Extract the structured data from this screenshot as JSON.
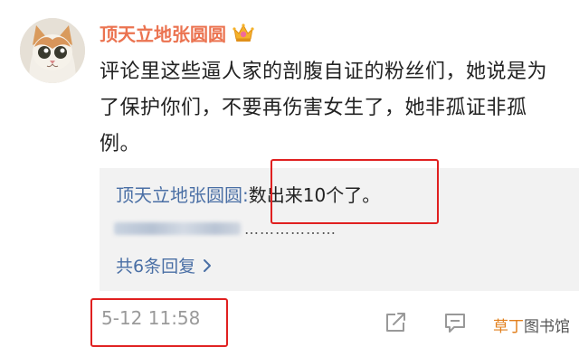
{
  "comment": {
    "username": "顶天立地张圆圆",
    "badge_icon": "crown-icon",
    "text": "评论里这些逼人家的剖腹自证的粉丝们，她说是为了保护你们，不要再伤害女生了，她非孤证非孤例。",
    "timestamp": "5-12 11:58"
  },
  "reply_preview": {
    "author": "顶天立地张圆圆",
    "separator": ":",
    "text": "数出来10个了。",
    "truncated_dots": "………………",
    "reply_count_label": "共6条回复",
    "chevron_icon": "chevron-right-icon"
  },
  "actions": {
    "share_icon": "share-icon",
    "comment_icon": "comment-icon"
  },
  "watermark": {
    "part_a": "草丁",
    "part_b": "图书馆"
  },
  "colors": {
    "username": "#eb7350",
    "link": "#4a6fa5",
    "highlight": "#e02020",
    "timestamp": "#9a9a9a",
    "reply_bg": "#f2f2f2"
  }
}
